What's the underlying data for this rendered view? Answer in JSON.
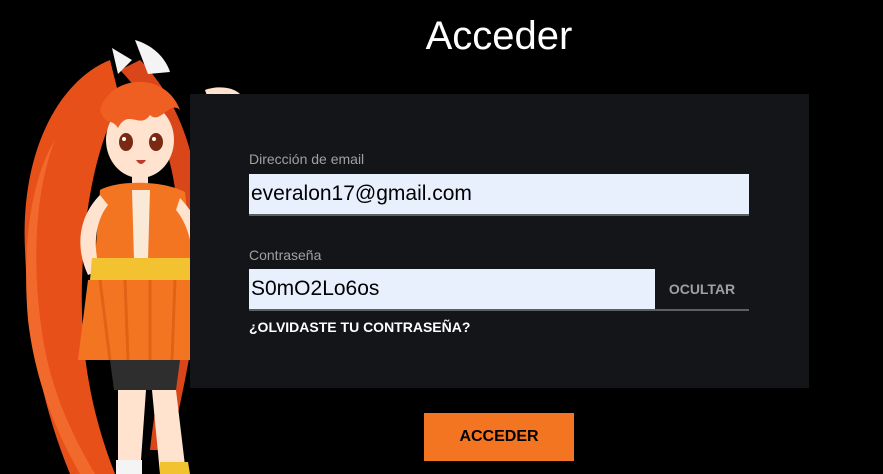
{
  "page": {
    "title": "Acceder"
  },
  "mascot": {
    "icon": "hime-mascot-icon"
  },
  "form": {
    "email_label": "Dirección de email",
    "email_value": "everalon17@gmail.com",
    "password_label": "Contraseña",
    "password_value": "S0mO2Lo6os",
    "toggle_label": "OCULTAR",
    "forgot_label": "¿OLVIDASTE TU CONTRASEÑA?",
    "submit_label": "ACCEDER"
  },
  "colors": {
    "background": "#000000",
    "panel": "#141519",
    "input_fill": "#e8f0fe",
    "accent": "#f47521",
    "label": "#a0a0a0"
  }
}
